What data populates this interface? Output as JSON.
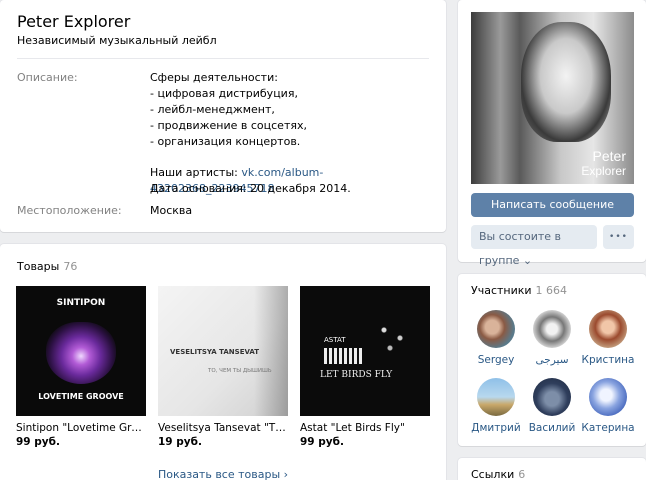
{
  "group": {
    "name": "Peter Explorer",
    "status": "Независимый музыкальный лейбл",
    "description_label": "Описание:",
    "description_lines": [
      "Сферы деятельности:",
      "- цифровая дистрибуция,",
      "- лейбл-менеджмент,",
      "- продвижение в соцсетях,",
      "- организация концертов."
    ],
    "artists_prefix": "Наши артисты: ",
    "artists_link": "vk.com/album-43202368_223945718",
    "founded": "Дата основания: 20 декабря 2014.",
    "location_label": "Местоположение:",
    "location_value": "Москва"
  },
  "products": {
    "title": "Товары",
    "count": "76",
    "items": [
      {
        "cover_top": "SINTIPON",
        "cover_bottom": "LOVETIME GROOVE",
        "name": "Sintipon \"Lovetime Groove\"",
        "price": "99 руб."
      },
      {
        "cover_top": "VESELITSYA TANSEVAT",
        "cover_bottom": "ТО, ЧЕМ ТЫ ДЫШИШЬ",
        "name": "Veselitsya Tansevat \"То, чем ты дышишь\"",
        "price": "19 руб."
      },
      {
        "cover_top": "ASTAT",
        "cover_bottom": "LET BIRDS FLY",
        "name": "Astat \"Let Birds Fly\"",
        "price": "99 руб."
      }
    ],
    "show_all": "Показать все товары ›"
  },
  "sidebar": {
    "avatar_caption_1": "Peter",
    "avatar_caption_2": "Explorer",
    "message_button": "Написать сообщение",
    "member_button": "Вы состоите в группе ⌄",
    "more_button": "•••",
    "members_title": "Участники",
    "members_count": "1 664",
    "members": [
      {
        "name": "Sergey"
      },
      {
        "name": "سیرجی"
      },
      {
        "name": "Кристина"
      },
      {
        "name": "Дмитрий"
      },
      {
        "name": "Василий"
      },
      {
        "name": "Катерина"
      }
    ],
    "links_title": "Ссылки",
    "links_count": "6"
  },
  "colors": {
    "page_bg": "#edeef0",
    "accent": "#5e81a8",
    "link": "#2a5885",
    "muted": "#828282"
  }
}
